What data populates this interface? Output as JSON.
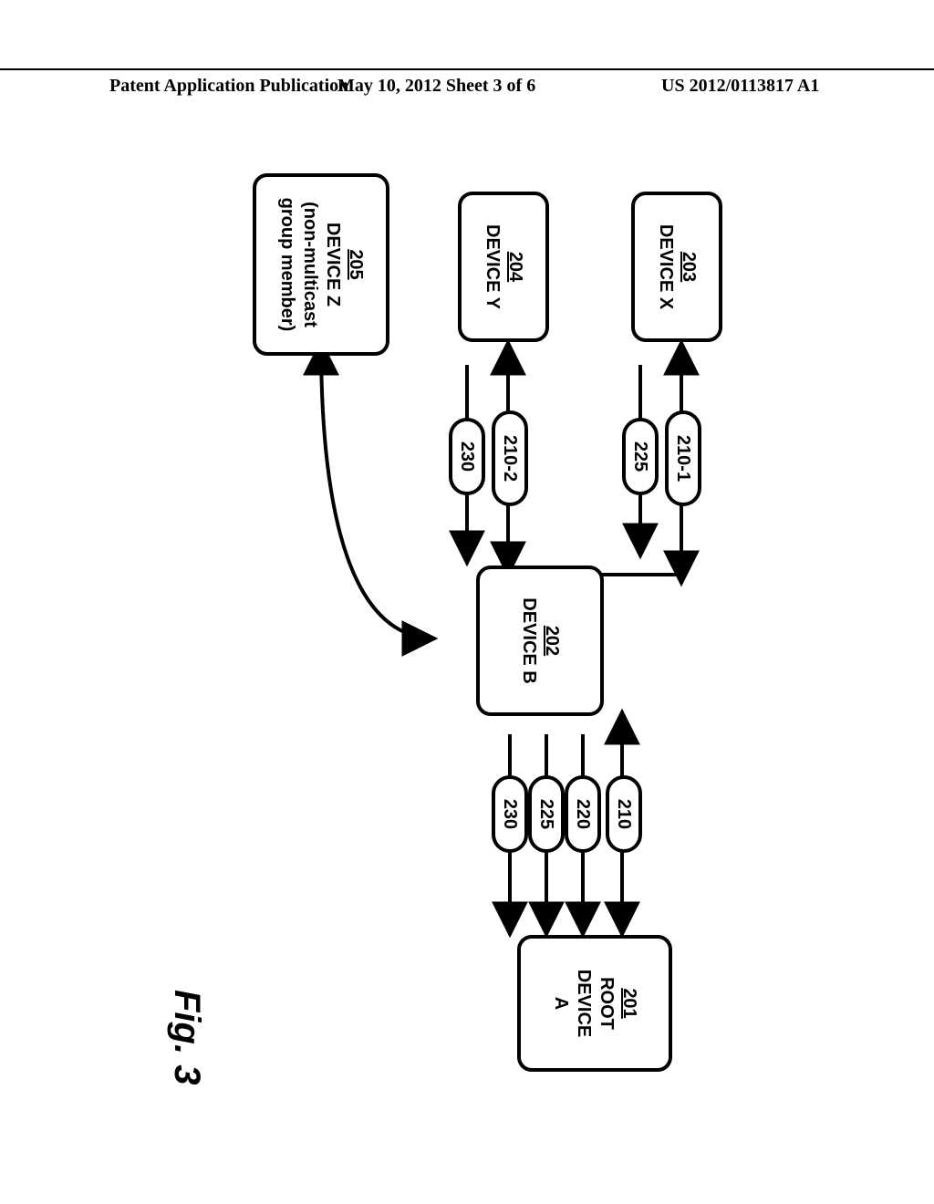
{
  "header": {
    "left": "Patent Application Publication",
    "center": "May 10, 2012  Sheet 3 of 6",
    "right": "US 2012/0113817 A1"
  },
  "figure_label": "Fig. 3",
  "devices": {
    "root": {
      "num": "201",
      "l1": "ROOT",
      "l2": "DEVICE",
      "l3": "A"
    },
    "b": {
      "num": "202",
      "l1": "DEVICE B"
    },
    "x": {
      "num": "203",
      "l1": "DEVICE X"
    },
    "y": {
      "num": "204",
      "l1": "DEVICE Y"
    },
    "z": {
      "num": "205",
      "l1": "DEVICE Z",
      "note1": "(non-multicast",
      "note2": "group member)"
    }
  },
  "messages": {
    "m210": "210",
    "m220": "220",
    "m225": "225",
    "m230": "230",
    "m210_1": "210-1",
    "m225b": "225",
    "m210_2": "210-2",
    "m230b": "230"
  }
}
